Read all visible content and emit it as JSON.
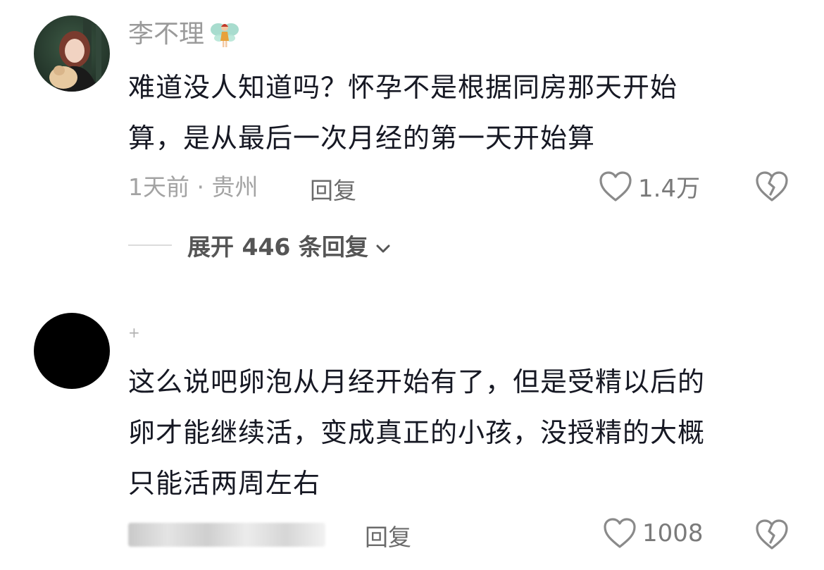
{
  "comments": [
    {
      "username": "李不理",
      "badge_icon": "fairy-emoji",
      "text_lines": [
        "难道没人知道吗？怀孕不是根据同房那天开始",
        "算，是从最后一次月经的第一天开始算"
      ],
      "meta": "1天前 · 贵州",
      "reply_label": "回复",
      "likes": "1.4万",
      "expand_label": "展开 446 条回复"
    },
    {
      "username": "+",
      "text_lines": [
        "这么说吧卵泡从月经开始有了，但是受精以后的",
        "卵才能继续活，变成真正的小孩，没授精的大概",
        "只能活两周左右"
      ],
      "reply_label": "回复",
      "likes": "1008"
    }
  ],
  "icons": {
    "like": "heart-outline-icon",
    "dislike": "broken-heart-icon",
    "expand": "chevron-down-icon"
  },
  "colors": {
    "text_primary": "#161823",
    "text_secondary": "#9a9a9a",
    "icon_gray": "#7a7a7a"
  }
}
